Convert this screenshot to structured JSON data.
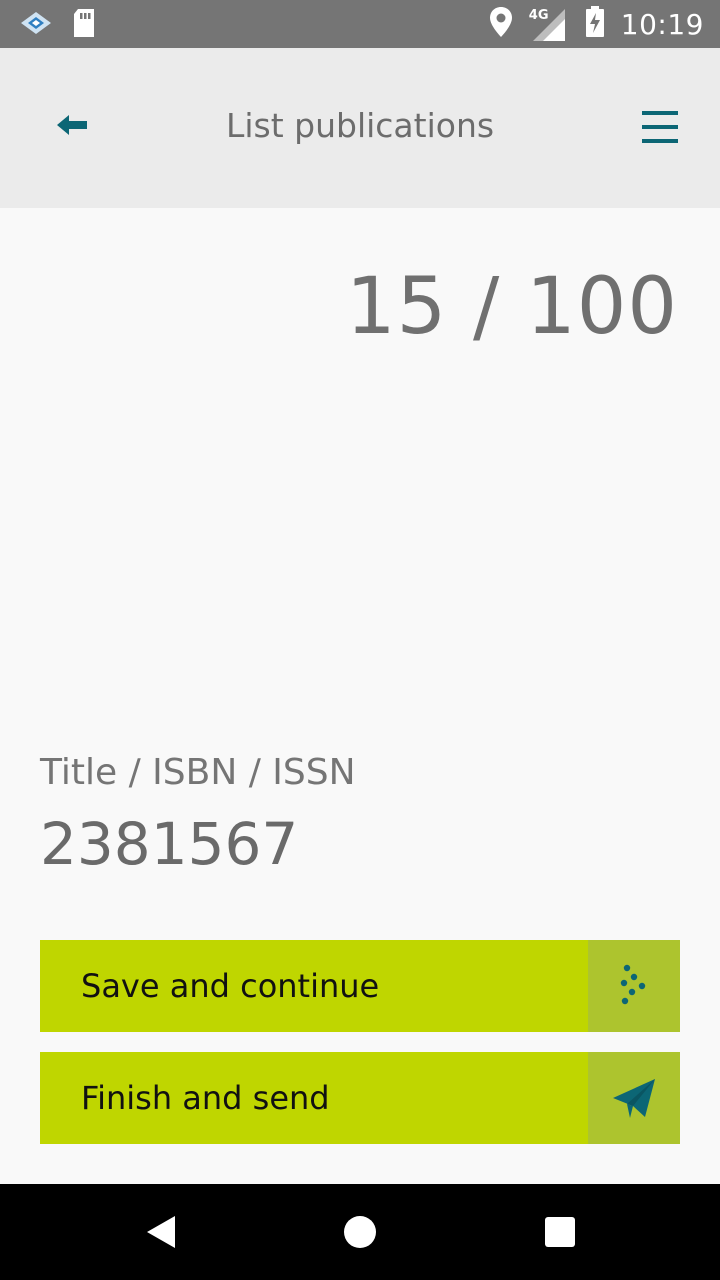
{
  "status_bar": {
    "time": "10:19",
    "network": "4G",
    "icons": [
      "app-notification-icon",
      "sd-card-icon",
      "location-icon",
      "signal-icon",
      "battery-charging-icon"
    ]
  },
  "header": {
    "title": "List publications",
    "back_icon": "back-arrow-icon",
    "menu_icon": "hamburger-menu-icon"
  },
  "counter": {
    "text": "15 / 100"
  },
  "field": {
    "label": "Title / ISBN / ISSN",
    "value": "2381567"
  },
  "buttons": {
    "save": {
      "label": "Save and continue",
      "icon": "dots-continue-icon"
    },
    "finish": {
      "label": "Finish and send",
      "icon": "paper-plane-send-icon"
    }
  },
  "nav": {
    "back_icon": "nav-back-icon",
    "home_icon": "nav-home-icon",
    "recent_icon": "nav-recent-icon"
  },
  "colors": {
    "accent": "#bfd600",
    "accent_dark": "#adc42e",
    "icon_teal": "#0c6675",
    "header_bg": "#ebebeb",
    "status_bg": "#757575"
  }
}
